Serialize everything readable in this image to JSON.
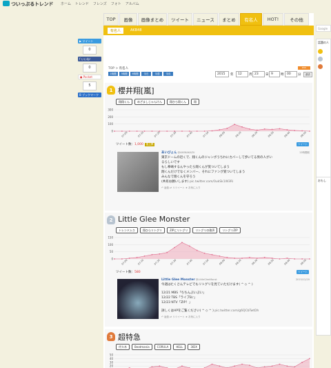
{
  "header": {
    "logo": "ついっぷるトレンド",
    "nav": [
      "ホーム",
      "トレンド",
      "フレンズ",
      "フォト",
      "アルバム"
    ]
  },
  "share": {
    "tweet_label": "ツイート",
    "tweet_count": "0",
    "like_label": "いいね！",
    "like_count": "0",
    "pocket_label": "Pocket",
    "pocket_count": "5",
    "bookmark_label": "ブックマーク"
  },
  "tabs": [
    {
      "label": "TOP"
    },
    {
      "label": "画像"
    },
    {
      "label": "画像まとめ"
    },
    {
      "label": "ツイート"
    },
    {
      "label": "ニュース"
    },
    {
      "label": "まとめ"
    },
    {
      "label": "有名人",
      "active": true
    },
    {
      "label": "HOT!"
    },
    {
      "label": "その他"
    }
  ],
  "subnav": {
    "active": "有名人",
    "other": "AKB48"
  },
  "breadcrumb": {
    "top": "TOP",
    "sep": ">",
    "current": "有名人"
  },
  "date_buttons": [
    "1時間",
    "3時間",
    "6時間",
    "今日",
    "今週",
    "今月"
  ],
  "date_select": {
    "year": "2015",
    "month": "12",
    "day": "23",
    "hour": "9",
    "min": "00"
  },
  "date_labels": {
    "year": "年",
    "month": "月",
    "day": "日",
    "hour": "時",
    "min": "分"
  },
  "history_button": "過去",
  "rss_badge": "RSS",
  "search_placeholder": "Google",
  "ranking": [
    {
      "rank": "1",
      "name": "櫻井翔[嵐]",
      "tags": [
        "翔翔くん",
        "めざましじゃんけん",
        "翔ひら翔くん",
        "翔"
      ],
      "tweet_count_label": "ツイート数：",
      "tweet_count": "1,000",
      "badge": "急上昇",
      "tweet": {
        "user": "あいびょん",
        "handle": "@AIKINAKAZU",
        "time": "12時間前",
        "lines": [
          "東京ドームの近くで、翔くんのジャンボうちわにカバーして歩いてる男の人がい",
          "るらしいです",
          "もし拳嶋するんやったら翔くんが覚ついてしまう",
          "翔くんだけでなくメンバー、それにファンが覚ついてしまう",
          "みんなで翔くんを守ろう",
          "(共有お願いします)"
        ],
        "link": "pic.twitter.com/0ukSk1W3Ri"
      },
      "chart_data": {
        "type": "area",
        "x": [
          "07:00",
          "07:10",
          "07:20",
          "07:30",
          "07:40",
          "07:50",
          "08:00",
          "08:10",
          "08:20",
          "08:30",
          "08:40",
          "08:50"
        ],
        "values": [
          0,
          0,
          0,
          0,
          0,
          0,
          0,
          0,
          0,
          0,
          0,
          0,
          0,
          5,
          20,
          40,
          95,
          60,
          30,
          15,
          30,
          25,
          35,
          20,
          10,
          5,
          0
        ],
        "ylim": [
          0,
          300
        ],
        "yticks": [
          0,
          100,
          200,
          300
        ],
        "color": "#f0b0c0"
      }
    },
    {
      "rank": "2",
      "name": "Little Glee Monster",
      "tags": [
        "トレンド入り",
        "翔ひらリトグリ",
        "ZIPにリトグリ",
        "リトグリの歌声",
        "リトグリZIP"
      ],
      "tweet_count_label": "ツイート数：",
      "tweet_count": "580",
      "tweet": {
        "user": "Little Glee Monster",
        "handle": "@LittleGleeMonst",
        "time": "2015/12/20",
        "lines": [
          "今週はたくさんテレビでもリトグリを見ていただけます( ^ ◇ ^ )",
          "",
          "12/21 MBS「ちちんぷいぷい」",
          "12/22 TBS「ライブB♪」",
          "12/23 NTV「ZIP！」",
          "",
          "詳しくはHPをご覧ください( ^ ◇ ^ )"
        ],
        "link": "pic.twitter.com/g6QCbTwtDh"
      },
      "chart_data": {
        "type": "area",
        "x": [
          "07:00",
          "07:10",
          "07:20",
          "07:30",
          "07:40",
          "07:50",
          "08:00",
          "08:10",
          "08:20",
          "08:30",
          "08:40",
          "08:50"
        ],
        "values": [
          0,
          0,
          5,
          10,
          20,
          30,
          35,
          45,
          80,
          115,
          90,
          60,
          40,
          30,
          20,
          10,
          5,
          5,
          10,
          5,
          10,
          5,
          0,
          5,
          0,
          0,
          0
        ],
        "ylim": [
          0,
          150
        ],
        "yticks": [
          0,
          50,
          100,
          150
        ],
        "color": "#f0b0c0"
      }
    },
    {
      "rank": "3",
      "name": "超特急",
      "tags": [
        "代々木",
        "Beatmania",
        "CORULA",
        "HELL",
        "3IDX"
      ],
      "chart_data": {
        "type": "area",
        "x": [
          "07:00",
          "07:10",
          "07:20",
          "07:30",
          "07:40",
          "07:50",
          "08:00",
          "08:10",
          "08:20",
          "08:30",
          "08:40",
          "08:50"
        ],
        "values": [
          10,
          12,
          15,
          12,
          10,
          18,
          20,
          15,
          12,
          20,
          15,
          10,
          15,
          25,
          20,
          15,
          20,
          25,
          22,
          15,
          18,
          20,
          25,
          20,
          18,
          30,
          40
        ],
        "ylim": [
          0,
          50
        ],
        "yticks": [
          0,
          10,
          20,
          30,
          40,
          50
        ],
        "color": "#f0b0c0"
      }
    }
  ],
  "sidebar": {
    "heading": "話題の人",
    "heading2": "おもし"
  },
  "actions": [
    "返信",
    "リツイート",
    "お気に入り"
  ]
}
